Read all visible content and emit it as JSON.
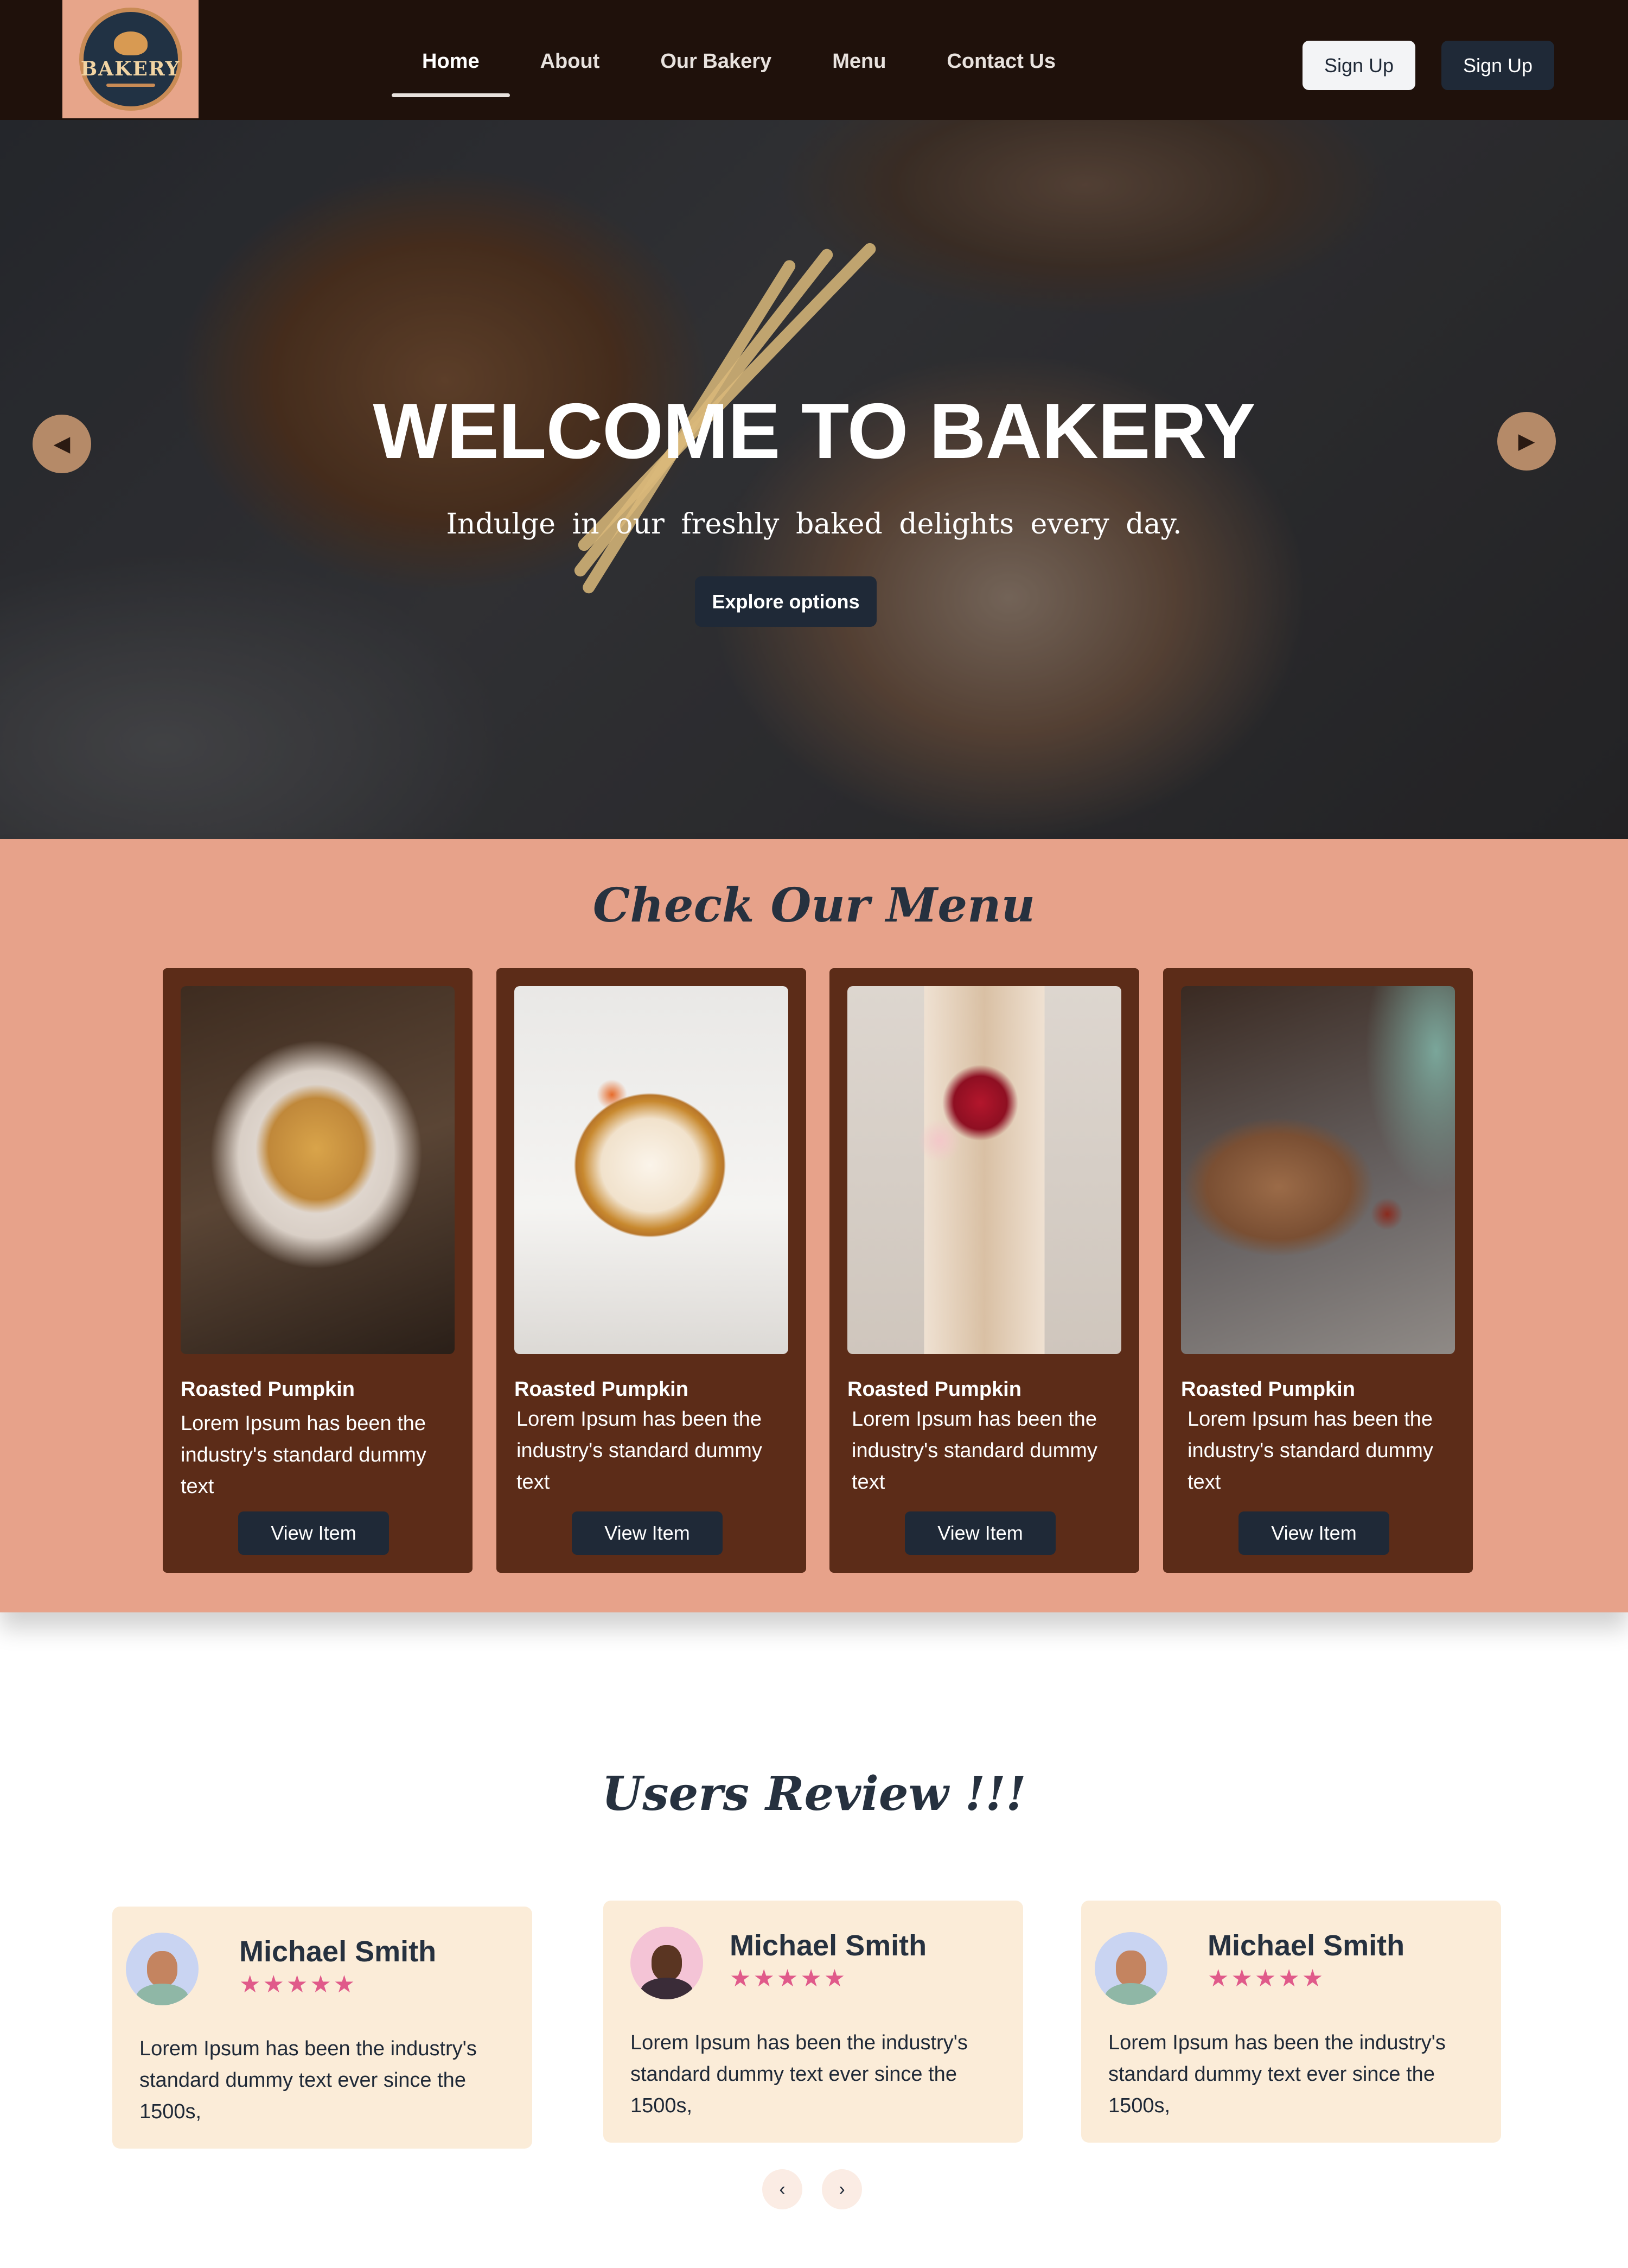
{
  "logo": {
    "text": "BAKERY",
    "icon": "bakery-logo-icon"
  },
  "nav": {
    "links": [
      "Home",
      "About",
      "Our Bakery",
      "Menu",
      "Contact Us"
    ],
    "active": "Home",
    "signup_light": "Sign Up",
    "signup_dark": "Sign Up"
  },
  "hero": {
    "title": "WELCOME TO BAKERY",
    "subtitle": "Indulge in our freshly baked delights every day.",
    "button": "Explore options",
    "prev_icon": "caret-left-icon",
    "next_icon": "caret-right-icon"
  },
  "menu": {
    "title": "Check Our Menu",
    "items": [
      {
        "name": "Roasted Pumpkin",
        "desc": "Lorem Ipsum has been the industry's standard dummy text",
        "button": "View Item"
      },
      {
        "name": "Roasted Pumpkin",
        "desc": "Lorem Ipsum has been the industry's standard dummy text",
        "button": "View Item"
      },
      {
        "name": "Roasted Pumpkin",
        "desc": "Lorem Ipsum has been the industry's standard dummy text",
        "button": "View Item"
      },
      {
        "name": "Roasted Pumpkin",
        "desc": "Lorem Ipsum has been the industry's standard dummy text",
        "button": "View Item"
      }
    ]
  },
  "reviews": {
    "title": "Users Review !!!",
    "items": [
      {
        "name": "Michael Smith",
        "stars": "★★★★★",
        "text": "Lorem Ipsum has been the industry's standard dummy text ever since the 1500s,"
      },
      {
        "name": "Michael Smith",
        "stars": "★★★★★",
        "text": "Lorem Ipsum has been the industry's standard dummy text ever since the 1500s,"
      },
      {
        "name": "Michael Smith",
        "stars": "★★★★★",
        "text": "Lorem Ipsum has been the industry's standard dummy text ever since the 1500s,"
      }
    ],
    "prev": "‹",
    "next": "›"
  },
  "colors": {
    "navbar": "#1f110b",
    "accent_dark": "#1f2937",
    "menu_bg": "#e7a28a",
    "card_bg": "#5c2c18",
    "review_bg": "#fbecd8",
    "star": "#e05a8a"
  }
}
